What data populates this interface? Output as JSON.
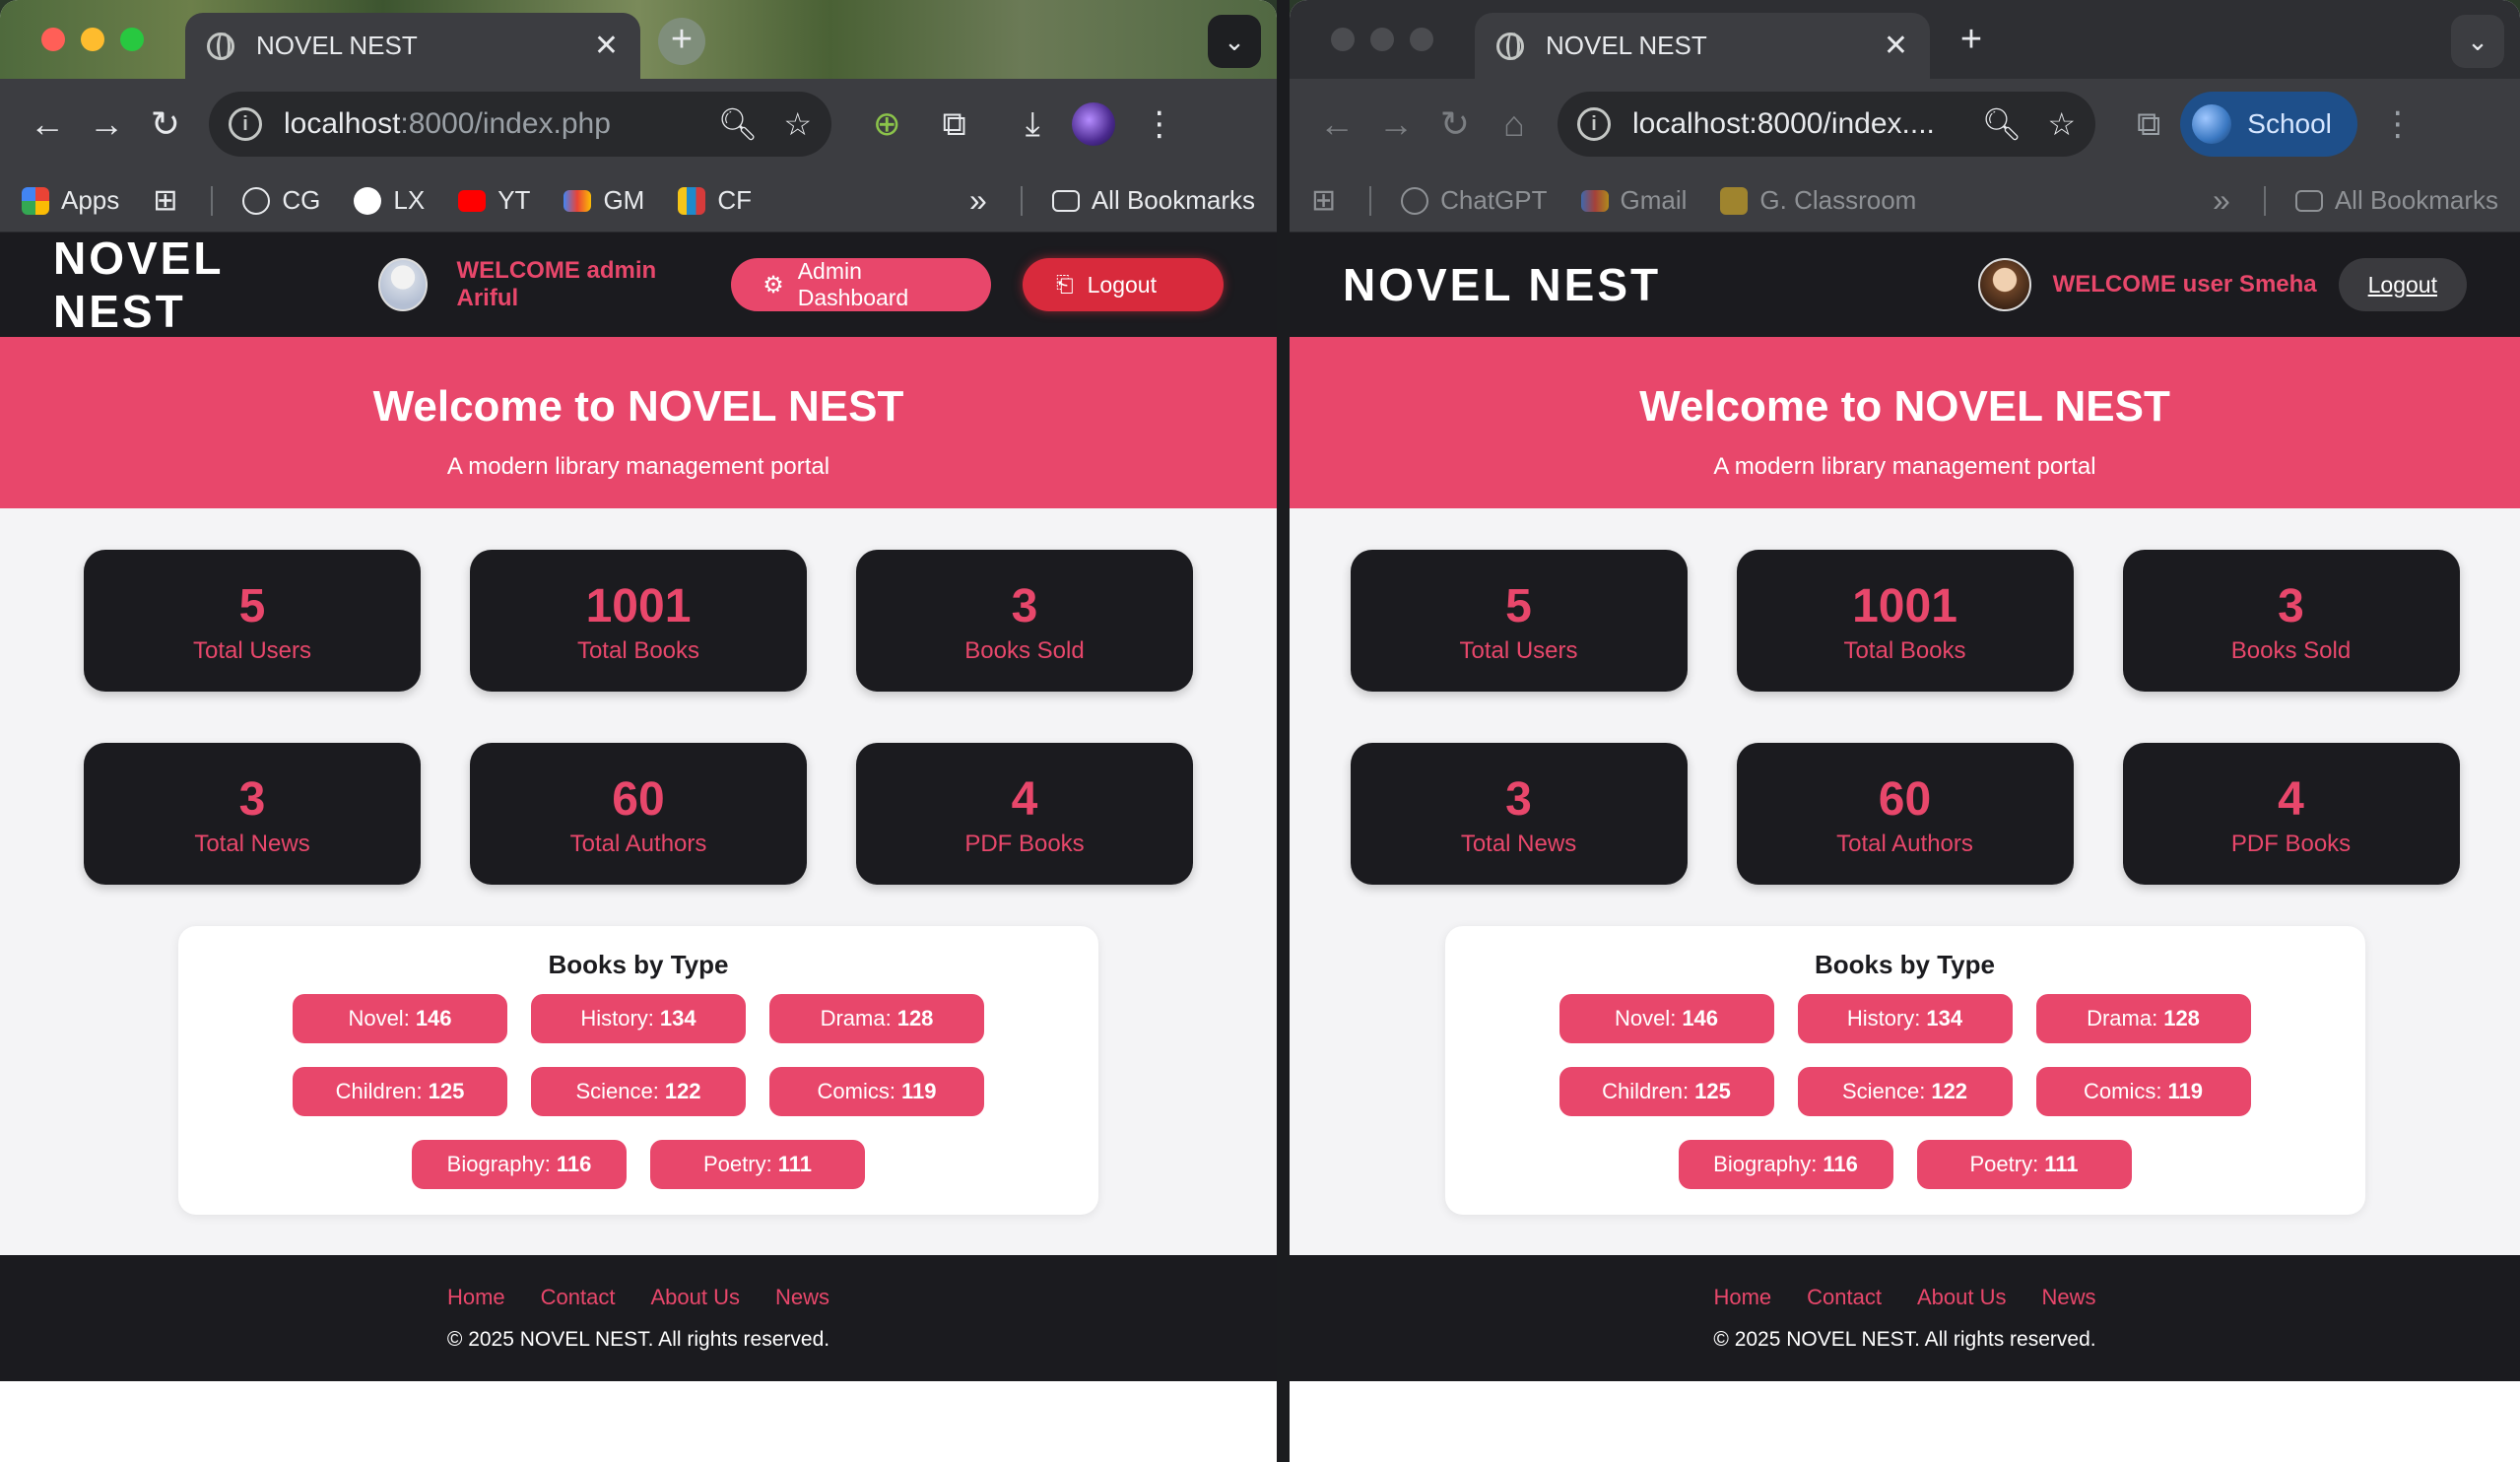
{
  "browser_left": {
    "tab_title": "NOVEL NEST",
    "url_host": "localhost",
    "url_path": ":8000/index.php",
    "bookmarks": [
      "Apps",
      "CG",
      "LX",
      "YT",
      "GM",
      "CF"
    ],
    "bookmarks_more": "»",
    "all_bookmarks": "All Bookmarks"
  },
  "browser_right": {
    "tab_title": "NOVEL NEST",
    "url_host": "localhost",
    "url_path": ":8000/index....",
    "profile_label": "School",
    "bookmarks": [
      "ChatGPT",
      "Gmail",
      "G. Classroom"
    ],
    "bookmarks_more": "»",
    "all_bookmarks": "All Bookmarks"
  },
  "site": {
    "brand": "NOVEL NEST",
    "hero_title": "Welcome to NOVEL NEST",
    "hero_subtitle": "A modern library management portal",
    "stats": [
      {
        "value": "5",
        "label": "Total Users"
      },
      {
        "value": "1001",
        "label": "Total Books"
      },
      {
        "value": "3",
        "label": "Books Sold"
      },
      {
        "value": "3",
        "label": "Total News"
      },
      {
        "value": "60",
        "label": "Total Authors"
      },
      {
        "value": "4",
        "label": "PDF Books"
      }
    ],
    "by_type_title": "Books by Type",
    "by_type": [
      {
        "label": "Novel:",
        "count": "146"
      },
      {
        "label": "History:",
        "count": "134"
      },
      {
        "label": "Drama:",
        "count": "128"
      },
      {
        "label": "Children:",
        "count": "125"
      },
      {
        "label": "Science:",
        "count": "122"
      },
      {
        "label": "Comics:",
        "count": "119"
      },
      {
        "label": "Biography:",
        "count": "116"
      },
      {
        "label": "Poetry:",
        "count": "111"
      }
    ],
    "footer_links": [
      "Home",
      "Contact",
      "About Us",
      "News"
    ],
    "copyright": "© 2025 NOVEL NEST. All rights reserved."
  },
  "left_header": {
    "welcome": "WELCOME admin Ariful",
    "admin_dashboard": "Admin Dashboard",
    "logout": "Logout"
  },
  "right_header": {
    "welcome": "WELCOME user Smeha",
    "logout": "Logout"
  },
  "colors": {
    "accent": "#e8476b",
    "dark": "#1b1b1f",
    "logout_red": "#d82a3c"
  }
}
